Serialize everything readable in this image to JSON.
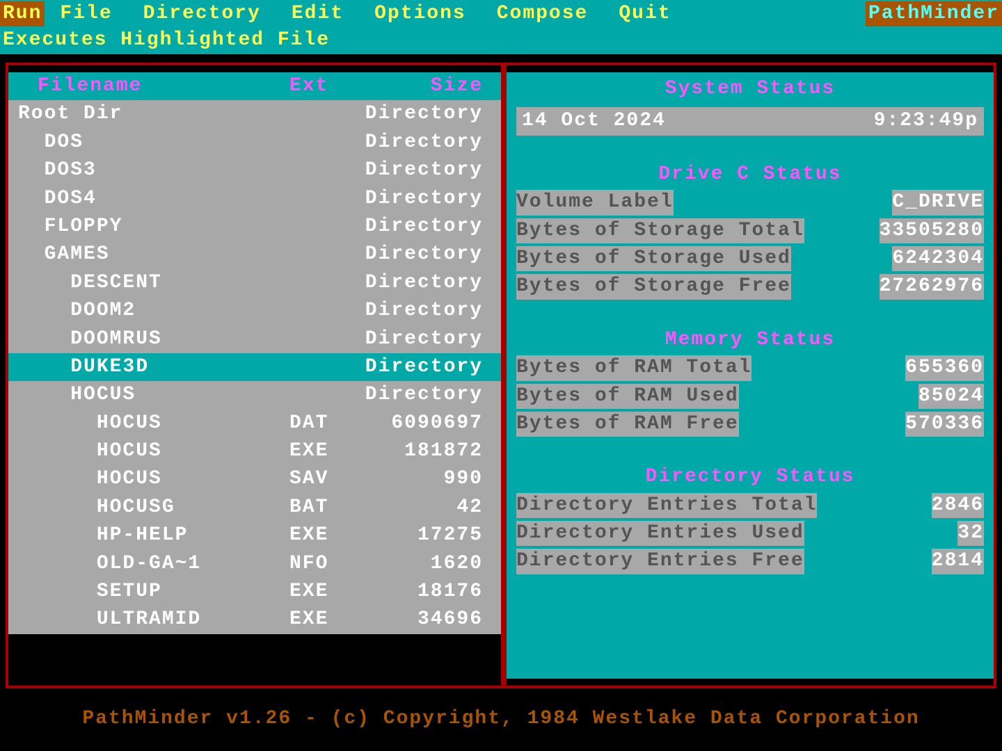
{
  "menu": {
    "run": "Run",
    "items": [
      "File",
      "Directory",
      "Edit",
      "Options",
      "Compose",
      "Quit"
    ],
    "brand": "PathMinder"
  },
  "hint": "Executes Highlighted File",
  "columns": {
    "filename": "Filename",
    "ext": "Ext",
    "size": "Size"
  },
  "files": [
    {
      "name": "Root Dir",
      "indent": 0,
      "ext": "",
      "size": "Directory",
      "sel": false
    },
    {
      "name": "DOS",
      "indent": 1,
      "ext": "",
      "size": "Directory",
      "sel": false
    },
    {
      "name": "DOS3",
      "indent": 1,
      "ext": "",
      "size": "Directory",
      "sel": false
    },
    {
      "name": "DOS4",
      "indent": 1,
      "ext": "",
      "size": "Directory",
      "sel": false
    },
    {
      "name": "FLOPPY",
      "indent": 1,
      "ext": "",
      "size": "Directory",
      "sel": false
    },
    {
      "name": "GAMES",
      "indent": 1,
      "ext": "",
      "size": "Directory",
      "sel": false
    },
    {
      "name": "DESCENT",
      "indent": 2,
      "ext": "",
      "size": "Directory",
      "sel": false
    },
    {
      "name": "DOOM2",
      "indent": 2,
      "ext": "",
      "size": "Directory",
      "sel": false
    },
    {
      "name": "DOOMRUS",
      "indent": 2,
      "ext": "",
      "size": "Directory",
      "sel": false
    },
    {
      "name": "DUKE3D",
      "indent": 2,
      "ext": "",
      "size": "Directory",
      "sel": true
    },
    {
      "name": "HOCUS",
      "indent": 2,
      "ext": "",
      "size": "Directory",
      "sel": false
    },
    {
      "name": "HOCUS",
      "indent": 3,
      "ext": "DAT",
      "size": "6090697",
      "sel": false
    },
    {
      "name": "HOCUS",
      "indent": 3,
      "ext": "EXE",
      "size": "181872",
      "sel": false
    },
    {
      "name": "HOCUS",
      "indent": 3,
      "ext": "SAV",
      "size": "990",
      "sel": false
    },
    {
      "name": "HOCUSG",
      "indent": 3,
      "ext": "BAT",
      "size": "42",
      "sel": false
    },
    {
      "name": "HP-HELP",
      "indent": 3,
      "ext": "EXE",
      "size": "17275",
      "sel": false
    },
    {
      "name": "OLD-GA~1",
      "indent": 3,
      "ext": "NFO",
      "size": "1620",
      "sel": false
    },
    {
      "name": "SETUP",
      "indent": 3,
      "ext": "EXE",
      "size": "18176",
      "sel": false
    },
    {
      "name": "ULTRAMID",
      "indent": 3,
      "ext": "EXE",
      "size": "34696",
      "sel": false
    }
  ],
  "status": {
    "system_title": "System Status",
    "date": "14 Oct 2024",
    "time": "9:23:49p",
    "drive_title": "Drive C Status",
    "drive": [
      {
        "label": "Volume Label",
        "value": "C_DRIVE"
      },
      {
        "label": "Bytes of Storage Total",
        "value": "33505280"
      },
      {
        "label": "Bytes of Storage Used",
        "value": "6242304"
      },
      {
        "label": "Bytes of Storage Free",
        "value": "27262976"
      }
    ],
    "mem_title": "Memory Status",
    "mem": [
      {
        "label": "Bytes of RAM Total",
        "value": "655360"
      },
      {
        "label": "Bytes of RAM Used",
        "value": "85024"
      },
      {
        "label": "Bytes of RAM Free",
        "value": "570336"
      }
    ],
    "dir_title": "Directory Status",
    "dir": [
      {
        "label": "Directory Entries Total",
        "value": "2846"
      },
      {
        "label": "Directory Entries Used",
        "value": "32"
      },
      {
        "label": "Directory Entries Free",
        "value": "2814"
      }
    ]
  },
  "footer": "PathMinder v1.26 - (c) Copyright, 1984 Westlake Data Corporation"
}
